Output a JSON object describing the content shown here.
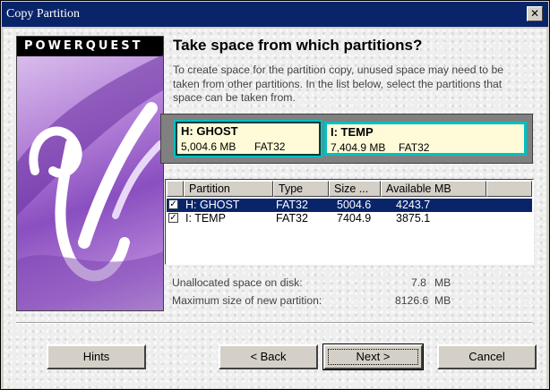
{
  "window": {
    "title": "Copy Partition",
    "close_glyph": "✕"
  },
  "branding": {
    "logo_text": "POWERQUEST"
  },
  "page": {
    "heading": "Take space from which partitions?",
    "instructions": "To create space for the partition copy, unused space may need to be taken from other partitions. In the list below, select the partitions that space can be taken from."
  },
  "partition_cards": [
    {
      "name": "H:  GHOST",
      "size": "5,004.6 MB",
      "fs": "FAT32"
    },
    {
      "name": "I:  TEMP",
      "size": "7,404.9 MB",
      "fs": "FAT32"
    }
  ],
  "table": {
    "headers": [
      "Partition",
      "Type",
      "Size ...",
      "Available MB"
    ],
    "rows": [
      {
        "checked": true,
        "check_glyph": "✓",
        "partition": "H: GHOST",
        "type": "FAT32",
        "size": "5004.6",
        "available": "4243.7",
        "selected": true
      },
      {
        "checked": true,
        "check_glyph": "✓",
        "partition": "I: TEMP",
        "type": "FAT32",
        "size": "7404.9",
        "available": "3875.1",
        "selected": false
      }
    ]
  },
  "stats": {
    "unallocated_label": "Unallocated space on disk:",
    "unallocated_value": "7.8",
    "unallocated_unit": "MB",
    "max_label": "Maximum size of new partition:",
    "max_value": "8126.6",
    "max_unit": "MB"
  },
  "buttons": {
    "hints": "Hints",
    "back": "< Back",
    "next": "Next >",
    "cancel": "Cancel"
  },
  "colors": {
    "titlebar": "#0a246a",
    "selection": "#0a246a",
    "card_border": "#00c0c0",
    "card_fill": "#fffbd8"
  }
}
